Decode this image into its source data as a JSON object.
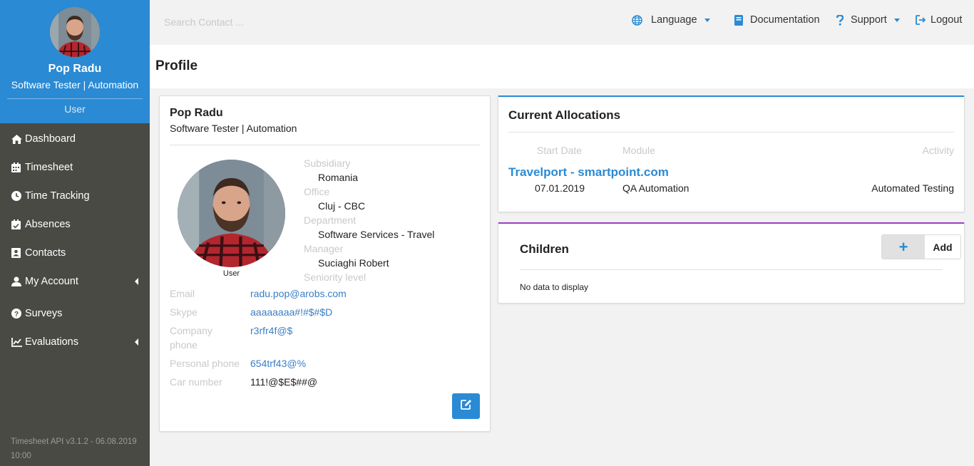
{
  "user": {
    "name": "Pop Radu",
    "job": "Software Tester | Automation",
    "role": "User"
  },
  "sidebar": {
    "items": [
      {
        "label": "Dashboard",
        "icon": "home-icon"
      },
      {
        "label": "Timesheet",
        "icon": "calendar-icon"
      },
      {
        "label": "Time Tracking",
        "icon": "clock-icon"
      },
      {
        "label": "Absences",
        "icon": "calendar-check-icon"
      },
      {
        "label": "Contacts",
        "icon": "contact-card-icon"
      },
      {
        "label": "My Account",
        "icon": "user-icon",
        "expandable": true
      },
      {
        "label": "Surveys",
        "icon": "question-circle-icon"
      },
      {
        "label": "Evaluations",
        "icon": "line-chart-icon",
        "expandable": true
      }
    ],
    "version": "Timesheet API v3.1.2 - 06.08.2019 10:00"
  },
  "topbar": {
    "search_placeholder": "Search Contact ...",
    "language": "Language",
    "documentation": "Documentation",
    "support": "Support",
    "logout": "Logout"
  },
  "page": {
    "title": "Profile"
  },
  "profile": {
    "avatar_caption": "User",
    "info": [
      {
        "label": "Subsidiary",
        "value": "Romania"
      },
      {
        "label": "Office",
        "value": "Cluj - CBC"
      },
      {
        "label": "Department",
        "value": "Software Services - Travel"
      },
      {
        "label": "Manager",
        "value": "Suciaghi Robert"
      },
      {
        "label": "Seniority level",
        "value": ""
      }
    ],
    "contacts": [
      {
        "label": "Email",
        "value": "radu.pop@arobs.com"
      },
      {
        "label": "Skype",
        "value": "aaaaaaaa#!#$#$D"
      },
      {
        "label": "Company phone",
        "value": "r3rfr4f@$"
      },
      {
        "label": "Personal phone",
        "value": "654trf43@%"
      },
      {
        "label": "Car number",
        "value": "111!@$E$##@"
      }
    ]
  },
  "allocations": {
    "title": "Current Allocations",
    "headers": {
      "start_date": "Start Date",
      "module": "Module",
      "activity": "Activity"
    },
    "project": "Travelport - smartpoint.com",
    "rows": [
      {
        "start_date": "07.01.2019",
        "module": "QA Automation",
        "activity": "Automated Testing"
      }
    ]
  },
  "children": {
    "title": "Children",
    "add_symbol": "+",
    "add_label": "Add",
    "empty_text": "No data to display"
  },
  "colors": {
    "accent": "#2a8ad4",
    "sidebar_bg": "#4a4a44",
    "children_accent": "#9b3fbf"
  }
}
